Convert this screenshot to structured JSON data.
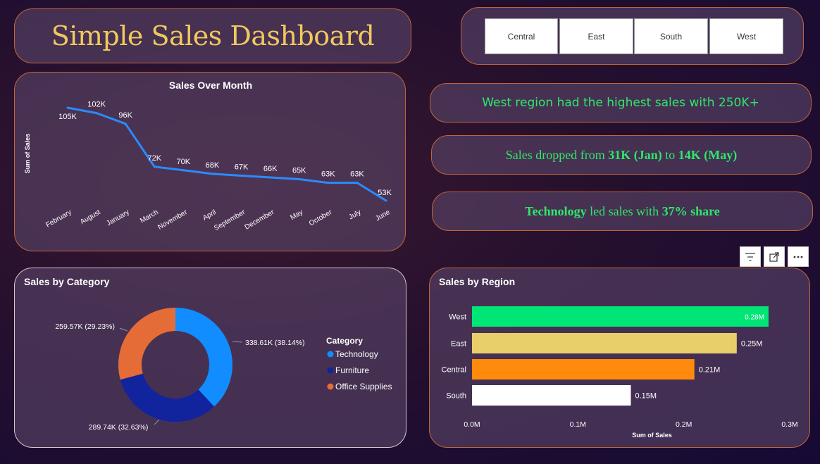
{
  "header": {
    "title": "Simple Sales Dashboard"
  },
  "slicer": {
    "regions": [
      "Central",
      "East",
      "South",
      "West"
    ]
  },
  "insights": {
    "i1": {
      "text": "West region had the highest sales with 250K+"
    },
    "i2": {
      "p1": "Sales dropped from ",
      "b1": "31K (Jan)",
      "p2": " to ",
      "b2": "14K (May)"
    },
    "i3": {
      "b1": "Technology",
      "p1": " led sales with ",
      "b2": "37% share"
    }
  },
  "colors": {
    "line": "#2a8bff",
    "donut": [
      "#118dff",
      "#12239e",
      "#e66c37"
    ],
    "bars": [
      "#00e676",
      "#e8cf6a",
      "#ff8a0c",
      "#ffffff"
    ]
  },
  "chart_data": [
    {
      "type": "line",
      "title": "Sales Over Month",
      "ylabel": "Sum of Sales",
      "xlabel": "",
      "categories": [
        "February",
        "August",
        "January",
        "March",
        "November",
        "April",
        "September",
        "December",
        "May",
        "October",
        "July",
        "June"
      ],
      "values": [
        105,
        102,
        96,
        72,
        70,
        68,
        67,
        66,
        65,
        63,
        63,
        53
      ],
      "labels": [
        "105K",
        "102K",
        "96K",
        "72K",
        "70K",
        "68K",
        "67K",
        "66K",
        "65K",
        "63K",
        "63K",
        "53K"
      ],
      "series": [
        {
          "values": [
            105,
            102,
            96,
            72,
            70,
            68,
            67,
            66,
            65,
            63,
            63,
            53
          ]
        }
      ]
    },
    {
      "type": "pie",
      "title": "Sales by Category",
      "legend_title": "Category",
      "legend_position": "right",
      "categories": [
        "Technology",
        "Furniture",
        "Office Supplies"
      ],
      "values": [
        338.61,
        289.74,
        259.57
      ],
      "labels": [
        "338.61K (38.14%)",
        "289.74K (32.63%)",
        "259.57K (29.23%)"
      ]
    },
    {
      "type": "bar",
      "orientation": "horizontal",
      "title": "Sales by Region",
      "xlabel": "Sum of Sales",
      "ylabel": "",
      "categories": [
        "West",
        "East",
        "Central",
        "South"
      ],
      "values": [
        0.28,
        0.25,
        0.21,
        0.15
      ],
      "labels": [
        "0.28M",
        "0.25M",
        "0.21M",
        "0.15M"
      ],
      "xlim": [
        0,
        0.3
      ],
      "ticks": [
        "0.0M",
        "0.1M",
        "0.2M",
        "0.3M"
      ]
    }
  ]
}
